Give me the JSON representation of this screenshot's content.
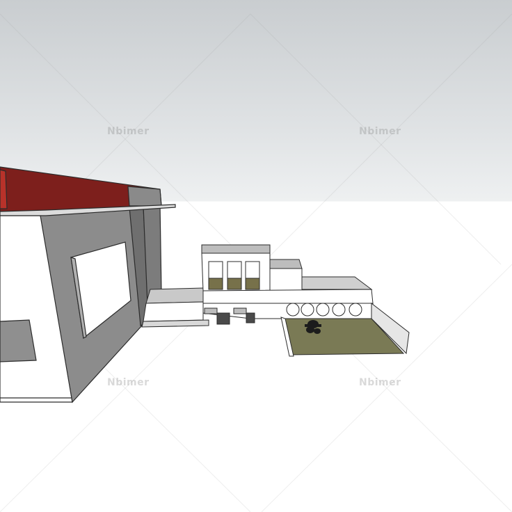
{
  "watermarks": [
    {
      "text": "Nbimer"
    },
    {
      "text": "Nbimer"
    },
    {
      "text": "Nbimer"
    },
    {
      "text": "Nbimer"
    }
  ],
  "colors": {
    "sky_top": "#c9cdd0",
    "sky_bottom": "#eef0f1",
    "ground": "#ffffff",
    "roof": "#7d1f1c",
    "roof_edge": "#b8322a",
    "wall_shadow": "#8a8a8a",
    "wall_light": "#ffffff",
    "lawn": "#7a7a55",
    "outline": "#2b2b2b"
  }
}
